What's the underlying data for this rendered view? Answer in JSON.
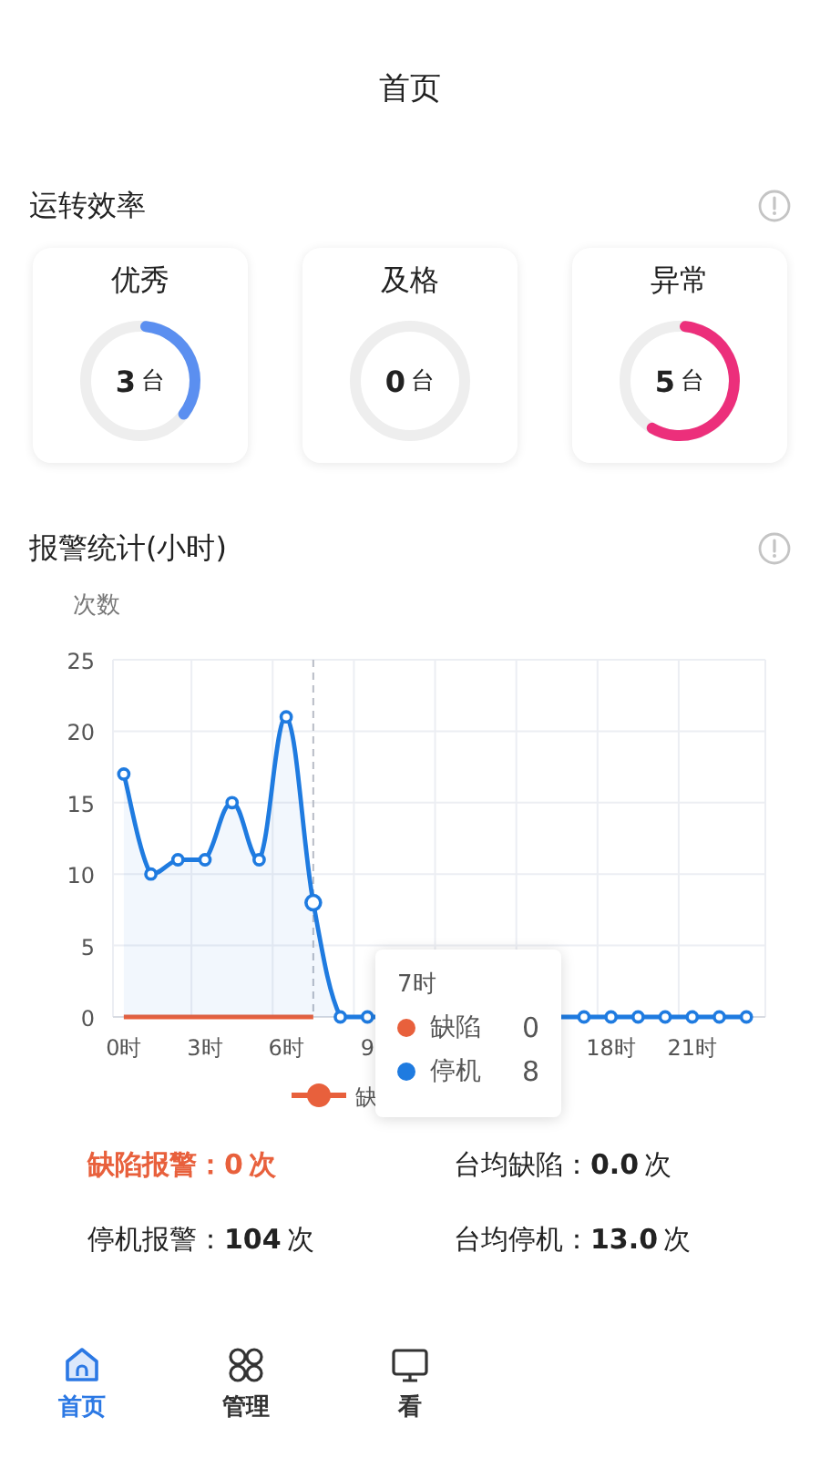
{
  "header": {
    "title": "首页"
  },
  "efficiency": {
    "title": "运转效率",
    "cards": [
      {
        "label": "优秀",
        "value": "3",
        "unit": "台",
        "level": 0.37,
        "color": "#5b8ff0"
      },
      {
        "label": "及格",
        "value": "0",
        "unit": "台"
      },
      {
        "label": "异常",
        "value": "5",
        "unit": "台",
        "level": 0.6,
        "color": "#ec2f7b"
      }
    ]
  },
  "alarms": {
    "title": "报警统计(小时)",
    "chart_data": {
      "type": "line",
      "ylabel": "次数",
      "x": [
        0,
        1,
        2,
        3,
        4,
        5,
        6,
        7,
        8,
        9,
        10,
        11,
        12,
        13,
        14,
        15,
        16,
        17,
        18,
        19,
        20,
        21,
        22,
        23
      ],
      "xlim": [
        -0.4,
        23.7
      ],
      "ylim": [
        0,
        25
      ],
      "yticks": [
        0,
        5,
        10,
        15,
        20,
        25
      ],
      "xticks": [
        {
          "value": 0,
          "label": "0时"
        },
        {
          "value": 3,
          "label": "3时"
        },
        {
          "value": 6,
          "label": "6时"
        },
        {
          "value": 9,
          "label": "9"
        },
        {
          "value": 18,
          "label": "18时"
        },
        {
          "value": 21,
          "label": "21时"
        }
      ],
      "grid": true,
      "legend": {
        "items": [
          {
            "label": "缺",
            "color": "#e8603c"
          }
        ]
      },
      "ref_lines": [
        {
          "axis": "x",
          "value": 7
        }
      ],
      "series": [
        {
          "name": "缺陷",
          "color": "#e8603c",
          "values": [
            0,
            0,
            0,
            0,
            0,
            0,
            0,
            0,
            null,
            null,
            null,
            null,
            null,
            null,
            null,
            null,
            null,
            null,
            null,
            null,
            null,
            null,
            null,
            null
          ]
        },
        {
          "name": "停机",
          "color": "#1f7be0",
          "marker": "circle",
          "values": [
            17,
            10,
            11,
            11,
            15,
            11,
            21,
            8,
            0,
            0,
            null,
            null,
            null,
            null,
            null,
            null,
            null,
            0,
            0,
            0,
            0,
            0,
            0,
            0
          ]
        }
      ]
    },
    "tooltip": {
      "title": "7时",
      "rows": [
        {
          "value": "0"
        },
        {
          "value": "8"
        }
      ]
    }
  },
  "stats": [
    {
      "label": "缺陷报警：",
      "value": "0",
      "unit": "次",
      "highlight": true
    },
    {
      "label": "台均缺陷：",
      "value": "0.0",
      "unit": "次",
      "highlight": false
    },
    {
      "label": "停机报警：",
      "value": "104",
      "unit": "次",
      "highlight": false
    },
    {
      "label": "台均停机：",
      "value": "13.0",
      "unit": "次",
      "highlight": false
    }
  ],
  "nav": [
    {
      "label": "首页",
      "kind": "home",
      "selected": true
    },
    {
      "label": "管理",
      "kind": "grid",
      "selected": false
    },
    {
      "label": "看",
      "kind": "screen",
      "selected": false
    }
  ]
}
